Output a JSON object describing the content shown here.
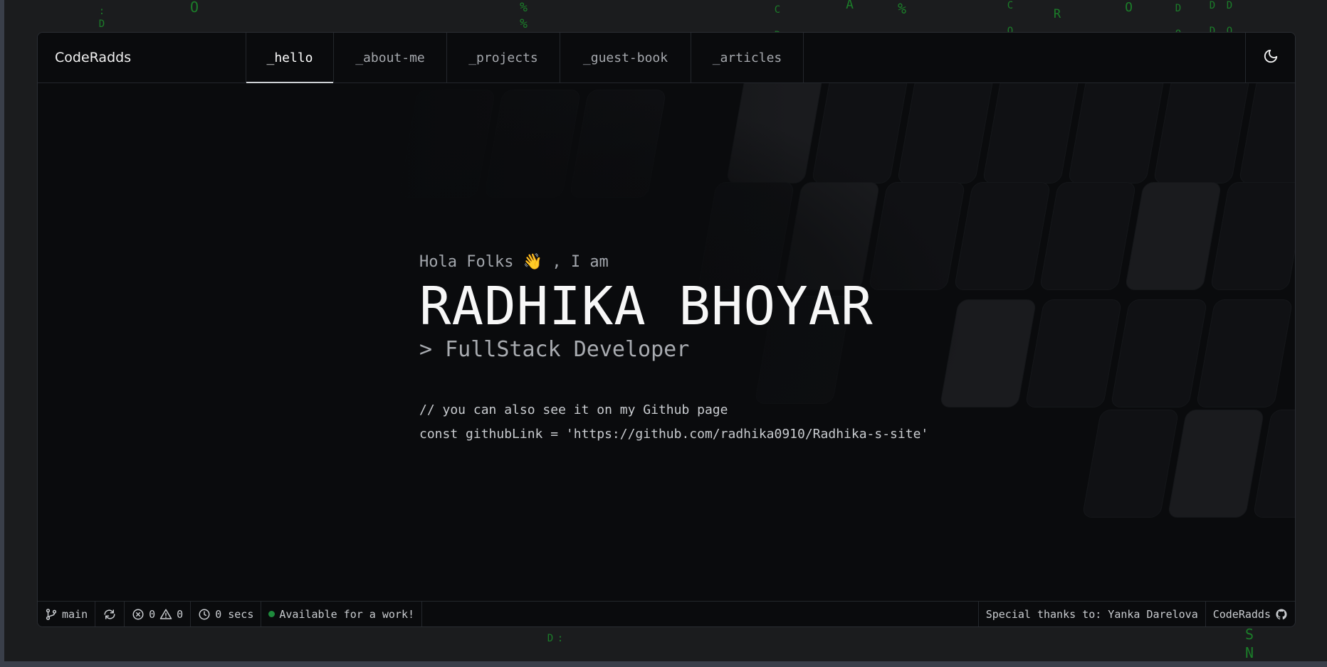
{
  "nav": {
    "brand": "CodeRadds",
    "tabs": [
      {
        "label": "_hello",
        "active": true
      },
      {
        "label": "_about-me",
        "active": false
      },
      {
        "label": "_projects",
        "active": false
      },
      {
        "label": "_guest-book",
        "active": false
      },
      {
        "label": "_articles",
        "active": false
      }
    ],
    "theme_icon": "moon-icon"
  },
  "hero": {
    "greeting": "Hola Folks 👋 , I am",
    "name": "RADHIKA BHOYAR",
    "role": "> FullStack Developer",
    "comment": "// you can also see it on my Github page",
    "code": "const githubLink = 'https://github.com/radhika0910/Radhika-s-site'"
  },
  "statusbar": {
    "branch": "main",
    "errors": "0",
    "warnings": "0",
    "time": "0 secs",
    "availability": "Available for a work!",
    "thanks": "Special thanks to: Yanka Darelova",
    "author": "CodeRadds"
  },
  "colors": {
    "accent_green": "#1e8a3c",
    "matrix_green": "#1c8f2c",
    "background": "#0a0b0d"
  }
}
